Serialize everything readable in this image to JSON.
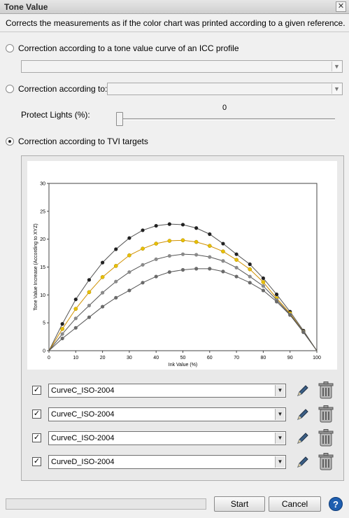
{
  "window": {
    "title": "Tone Value",
    "close_glyph": "✕"
  },
  "description": "Corrects the measurements as if the color chart was printed according to a given reference.",
  "options": {
    "icc_label": "Correction according to a tone value curve of an ICC profile",
    "according_label": "Correction according to:",
    "protect_lights_label": "Protect Lights (%):",
    "protect_lights_value": "0",
    "protect_lights_level": 0,
    "tvi_label": "Correction according to TVI targets"
  },
  "curves": [
    {
      "label": "CurveC_ISO-2004",
      "checked": true
    },
    {
      "label": "CurveC_ISO-2004",
      "checked": true
    },
    {
      "label": "CurveC_ISO-2004",
      "checked": true
    },
    {
      "label": "CurveD_ISO-2004",
      "checked": true
    }
  ],
  "buttons": {
    "start": "Start",
    "cancel": "Cancel",
    "help": "?"
  },
  "chart_data": {
    "type": "line",
    "xlabel": "Ink Value (%)",
    "ylabel": "Tone Value Increase (According to XYZ)",
    "xlim": [
      0,
      100
    ],
    "ylim": [
      0,
      30
    ],
    "xticks": [
      0,
      10,
      20,
      30,
      40,
      50,
      60,
      70,
      80,
      90,
      100
    ],
    "yticks": [
      0,
      5,
      10,
      15,
      20,
      25,
      30
    ],
    "grid": false,
    "x": [
      0,
      5,
      10,
      15,
      20,
      25,
      30,
      35,
      40,
      45,
      50,
      55,
      60,
      65,
      70,
      75,
      80,
      85,
      90,
      95,
      100
    ],
    "series": [
      {
        "color": "#222222",
        "values": [
          0,
          4.8,
          9.2,
          12.7,
          15.8,
          18.2,
          20.2,
          21.6,
          22.4,
          22.7,
          22.6,
          22.0,
          20.9,
          19.2,
          17.3,
          15.5,
          13.0,
          10.1,
          7.0,
          3.6,
          0
        ]
      },
      {
        "color": "#e8c000",
        "values": [
          0,
          3.9,
          7.5,
          10.5,
          13.2,
          15.2,
          17.1,
          18.3,
          19.2,
          19.7,
          19.8,
          19.5,
          18.8,
          17.8,
          16.3,
          14.6,
          12.3,
          9.4,
          6.7,
          3.4,
          0
        ]
      },
      {
        "color": "#8a8a8a",
        "values": [
          0,
          3.0,
          5.8,
          8.1,
          10.4,
          12.4,
          14.1,
          15.4,
          16.4,
          17.0,
          17.3,
          17.2,
          16.8,
          16.1,
          14.9,
          13.3,
          11.6,
          9.1,
          6.5,
          3.4,
          0
        ]
      },
      {
        "color": "#6a6a6a",
        "values": [
          0,
          2.2,
          4.1,
          6.0,
          7.9,
          9.5,
          10.8,
          12.2,
          13.3,
          14.1,
          14.5,
          14.7,
          14.7,
          14.2,
          13.3,
          12.2,
          10.8,
          8.8,
          6.4,
          3.3,
          0
        ]
      }
    ]
  }
}
